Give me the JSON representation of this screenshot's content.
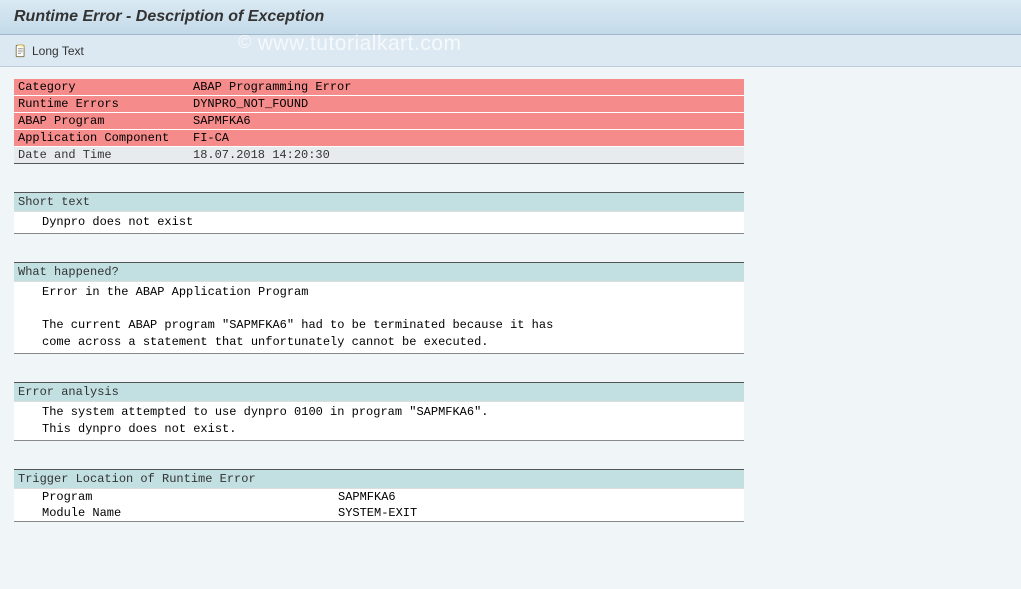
{
  "title": "Runtime Error - Description of Exception",
  "toolbar": {
    "long_text_label": "Long Text"
  },
  "info": {
    "category_label": "Category",
    "category_value": "ABAP Programming Error",
    "runtime_errors_label": "Runtime Errors",
    "runtime_errors_value": "DYNPRO_NOT_FOUND",
    "abap_program_label": "ABAP Program",
    "abap_program_value": "SAPMFKA6",
    "app_component_label": "Application Component",
    "app_component_value": "FI-CA",
    "date_time_label": "Date and Time",
    "date_time_value": "18.07.2018 14:20:30"
  },
  "sections": {
    "short_text": {
      "header": "Short text",
      "body": "Dynpro does not exist"
    },
    "what_happened": {
      "header": "What happened?",
      "line1": "Error in the ABAP Application Program",
      "line2": "The current ABAP program \"SAPMFKA6\" had to be terminated because it has",
      "line3": "come across a statement that unfortunately cannot be executed."
    },
    "error_analysis": {
      "header": "Error analysis",
      "line1": "The system attempted to use dynpro 0100 in program \"SAPMFKA6\".",
      "line2": "This dynpro does not exist."
    },
    "trigger": {
      "header": "Trigger Location of Runtime Error",
      "program_label": "Program",
      "program_value": "SAPMFKA6",
      "module_label": "Module Name",
      "module_value": "SYSTEM-EXIT"
    }
  },
  "watermark": {
    "copyright": "©",
    "text": "www.tutorialkart.com"
  }
}
